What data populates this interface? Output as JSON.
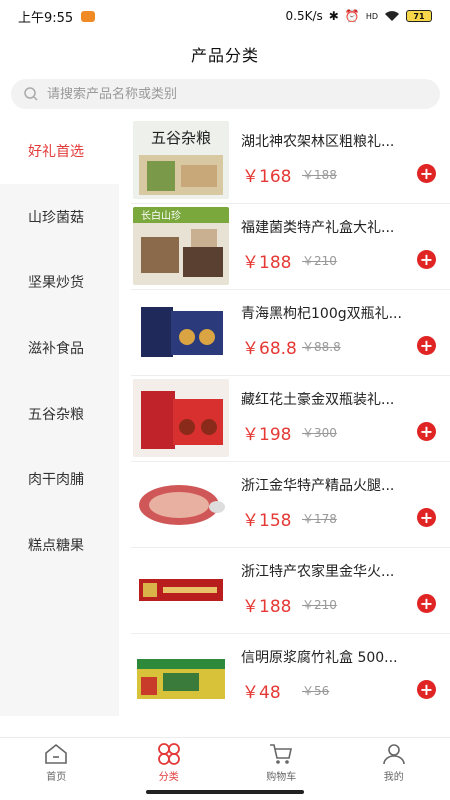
{
  "status_bar": {
    "time": "上午9:55",
    "speed": "0.5K/s",
    "network": "HD",
    "battery": "71"
  },
  "header": {
    "title": "产品分类"
  },
  "search": {
    "placeholder": "请搜索产品名称或类别"
  },
  "sidebar": {
    "items": [
      {
        "label": "好礼首选",
        "active": true
      },
      {
        "label": "山珍菌菇"
      },
      {
        "label": "坚果炒货"
      },
      {
        "label": "滋补食品"
      },
      {
        "label": "五谷杂粮"
      },
      {
        "label": "肉干肉脯"
      },
      {
        "label": "糕点糖果"
      }
    ]
  },
  "products": [
    {
      "title": "湖北神农架林区粗粮礼...",
      "price": "￥168",
      "old_price": "￥188",
      "thumb_text": "五谷杂粮"
    },
    {
      "title": "福建菌类特产礼盒大礼...",
      "price": "￥188",
      "old_price": "￥210",
      "thumb_text": "长白山珍"
    },
    {
      "title": "青海黑枸杞100g双瓶礼...",
      "price": "￥68.8",
      "old_price": "￥88.8"
    },
    {
      "title": "藏红花土豪金双瓶装礼...",
      "price": "￥198",
      "old_price": "￥300"
    },
    {
      "title": "浙江金华特产精品火腿...",
      "price": "￥158",
      "old_price": "￥178"
    },
    {
      "title": "浙江特产农家里金华火...",
      "price": "￥188",
      "old_price": "￥210"
    },
    {
      "title": "信明原浆腐竹礼盒 500...",
      "price": "￥48",
      "old_price": "￥56"
    }
  ],
  "tabbar": {
    "items": [
      {
        "label": "首页",
        "icon": "home-icon"
      },
      {
        "label": "分类",
        "icon": "category-icon",
        "active": true
      },
      {
        "label": "购物车",
        "icon": "cart-icon"
      },
      {
        "label": "我的",
        "icon": "profile-icon"
      }
    ]
  },
  "colors": {
    "accent": "#e33a3a",
    "price": "#e53935",
    "add_button": "#e02424"
  }
}
